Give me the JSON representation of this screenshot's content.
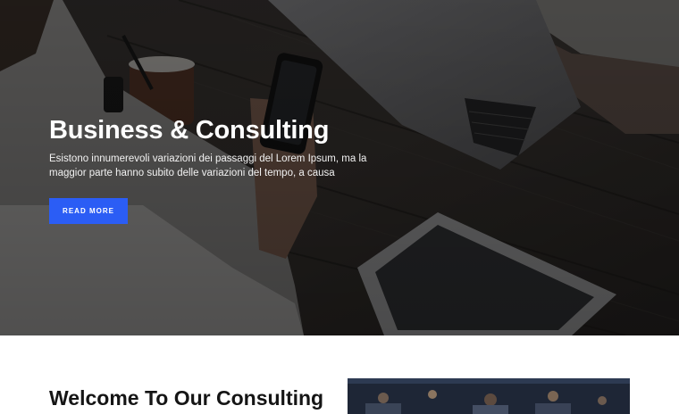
{
  "hero": {
    "title": "Business & Consulting",
    "text": "Esistono innumerevoli variazioni dei passaggi del Lorem Ipsum, ma la maggior parte hanno subito delle variazioni del tempo, a causa",
    "button_label": "READ MORE",
    "accent_color": "#2b5df5",
    "image": "office-meeting-photo"
  },
  "welcome": {
    "title": "Welcome To Our Consulting",
    "image": "team-photo"
  }
}
